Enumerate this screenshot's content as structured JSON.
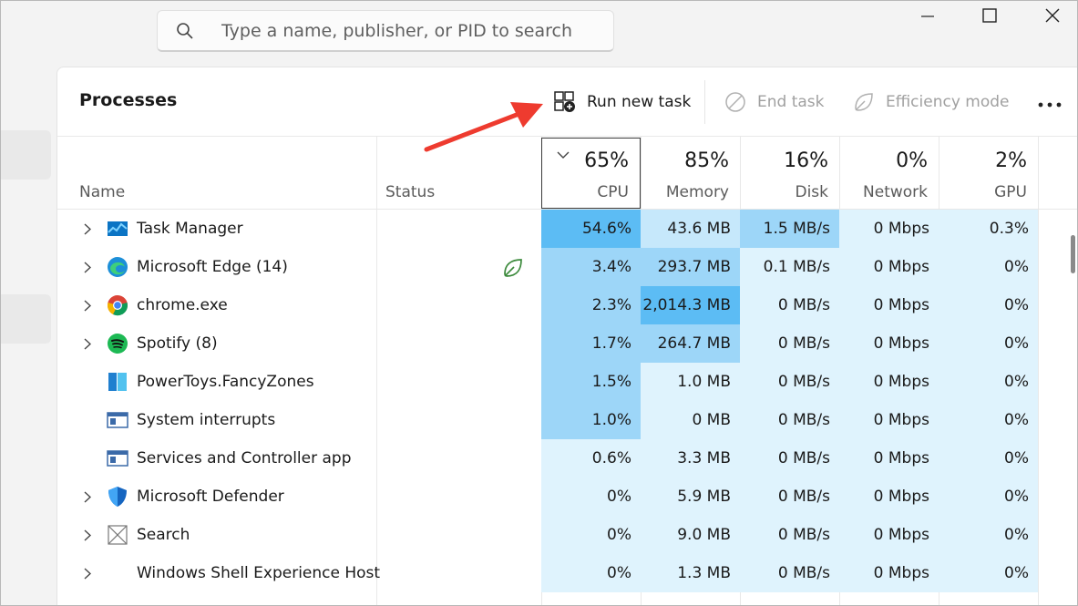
{
  "search": {
    "placeholder": "Type a name, publisher, or PID to search"
  },
  "window_controls": {
    "minimize": "minimize-icon",
    "maximize": "maximize-icon",
    "close": "close-icon"
  },
  "page": {
    "title": "Processes"
  },
  "toolbar": {
    "run_new_task": "Run new task",
    "end_task": "End task",
    "efficiency_mode": "Efficiency mode"
  },
  "columns": {
    "name": "Name",
    "status": "Status",
    "cpu": {
      "percent": "65%",
      "label": "CPU"
    },
    "memory": {
      "percent": "85%",
      "label": "Memory"
    },
    "disk": {
      "percent": "16%",
      "label": "Disk"
    },
    "network": {
      "percent": "0%",
      "label": "Network"
    },
    "gpu": {
      "percent": "2%",
      "label": "GPU"
    }
  },
  "colors": {
    "heat_very_low": "#dff3fd",
    "heat_low": "#c6e8fb",
    "heat_mid": "#9dd6f8",
    "heat_high": "#5cbcf4",
    "accent_arrow": "#ee3b2f",
    "leaf_green": "#3c8a3c"
  },
  "rows": [
    {
      "name": "Task Manager",
      "icon": "task-manager-icon",
      "expandable": true,
      "status": "",
      "cpu": "54.6%",
      "memory": "43.6 MB",
      "disk": "1.5 MB/s",
      "network": "0 Mbps",
      "gpu": "0.3%",
      "heat": [
        "high",
        "low",
        "mid",
        "very_low",
        "very_low"
      ]
    },
    {
      "name": "Microsoft Edge (14)",
      "icon": "edge-icon",
      "expandable": true,
      "status": "efficiency-leaf-icon",
      "cpu": "3.4%",
      "memory": "293.7 MB",
      "disk": "0.1 MB/s",
      "network": "0 Mbps",
      "gpu": "0%",
      "heat": [
        "mid",
        "mid",
        "very_low",
        "very_low",
        "very_low"
      ]
    },
    {
      "name": "chrome.exe",
      "icon": "chrome-icon",
      "expandable": true,
      "status": "",
      "cpu": "2.3%",
      "memory": "2,014.3 MB",
      "disk": "0 MB/s",
      "network": "0 Mbps",
      "gpu": "0%",
      "heat": [
        "mid",
        "high",
        "very_low",
        "very_low",
        "very_low"
      ]
    },
    {
      "name": "Spotify (8)",
      "icon": "spotify-icon",
      "expandable": true,
      "status": "",
      "cpu": "1.7%",
      "memory": "264.7 MB",
      "disk": "0 MB/s",
      "network": "0 Mbps",
      "gpu": "0%",
      "heat": [
        "mid",
        "mid",
        "very_low",
        "very_low",
        "very_low"
      ]
    },
    {
      "name": "PowerToys.FancyZones",
      "icon": "fancyzones-icon",
      "expandable": false,
      "status": "",
      "cpu": "1.5%",
      "memory": "1.0 MB",
      "disk": "0 MB/s",
      "network": "0 Mbps",
      "gpu": "0%",
      "heat": [
        "mid",
        "very_low",
        "very_low",
        "very_low",
        "very_low"
      ]
    },
    {
      "name": "System interrupts",
      "icon": "system-window-icon",
      "expandable": false,
      "status": "",
      "cpu": "1.0%",
      "memory": "0 MB",
      "disk": "0 MB/s",
      "network": "0 Mbps",
      "gpu": "0%",
      "heat": [
        "mid",
        "very_low",
        "very_low",
        "very_low",
        "very_low"
      ]
    },
    {
      "name": "Services and Controller app",
      "icon": "system-window-icon",
      "expandable": false,
      "status": "",
      "cpu": "0.6%",
      "memory": "3.3 MB",
      "disk": "0 MB/s",
      "network": "0 Mbps",
      "gpu": "0%",
      "heat": [
        "very_low",
        "very_low",
        "very_low",
        "very_low",
        "very_low"
      ]
    },
    {
      "name": "Microsoft Defender",
      "icon": "defender-shield-icon",
      "expandable": true,
      "status": "",
      "cpu": "0%",
      "memory": "5.9 MB",
      "disk": "0 MB/s",
      "network": "0 Mbps",
      "gpu": "0%",
      "heat": [
        "very_low",
        "very_low",
        "very_low",
        "very_low",
        "very_low"
      ]
    },
    {
      "name": "Search",
      "icon": "search-placeholder-icon",
      "expandable": true,
      "status": "",
      "cpu": "0%",
      "memory": "9.0 MB",
      "disk": "0 MB/s",
      "network": "0 Mbps",
      "gpu": "0%",
      "heat": [
        "very_low",
        "very_low",
        "very_low",
        "very_low",
        "very_low"
      ]
    },
    {
      "name": "Windows Shell Experience Host",
      "icon": "",
      "expandable": true,
      "status": "",
      "cpu": "0%",
      "memory": "1.3 MB",
      "disk": "0 MB/s",
      "network": "0 Mbps",
      "gpu": "0%",
      "heat": [
        "very_low",
        "very_low",
        "very_low",
        "very_low",
        "very_low"
      ]
    }
  ]
}
